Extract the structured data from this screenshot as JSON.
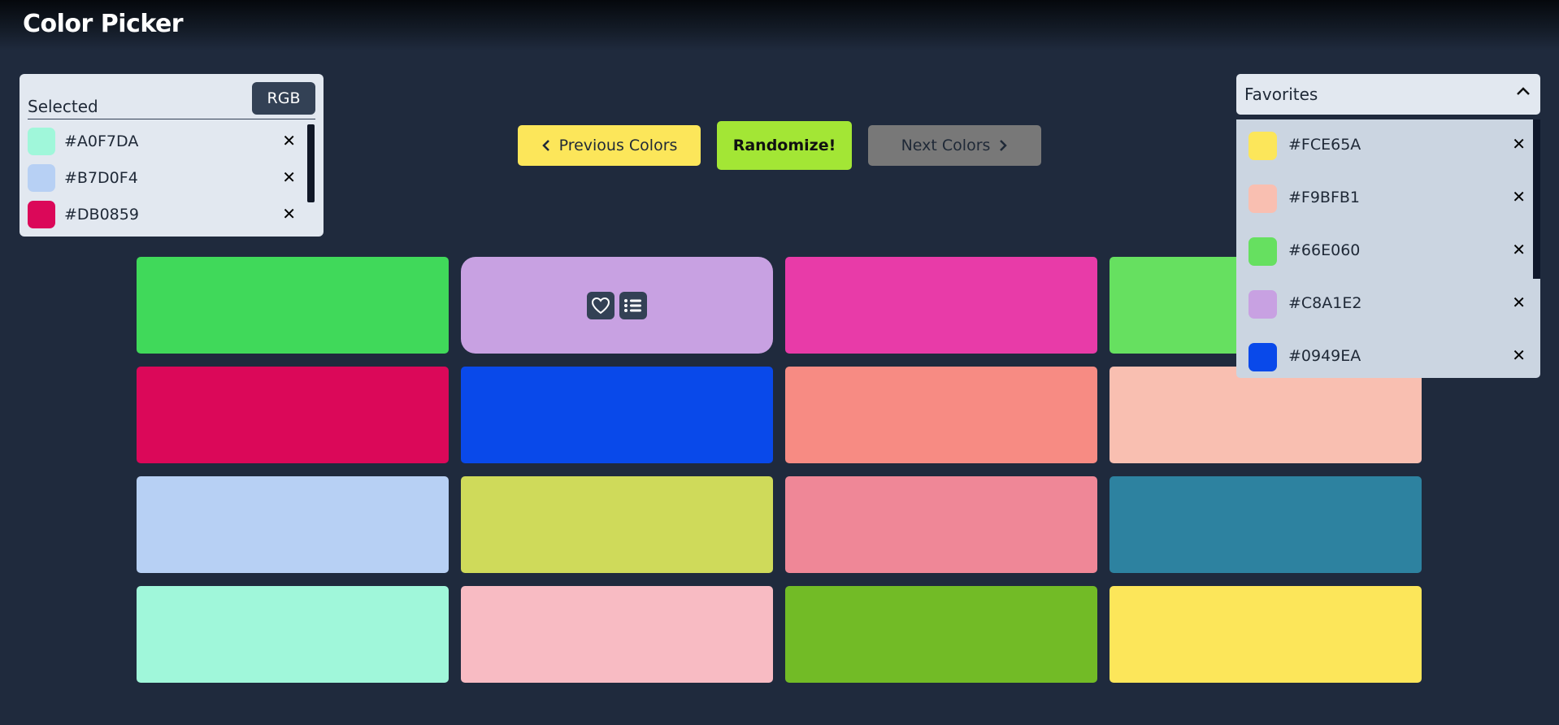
{
  "app": {
    "title": "Color Picker"
  },
  "selected": {
    "label": "Selected",
    "format_button": "RGB",
    "items": [
      {
        "hex": "#A0F7DA",
        "color": "#A0F7DA",
        "remove": "✕"
      },
      {
        "hex": "#B7D0F4",
        "color": "#B7D0F4",
        "remove": "✕"
      },
      {
        "hex": "#DB0859",
        "color": "#DB0859",
        "remove": "✕"
      }
    ]
  },
  "actions": {
    "previous": "Previous Colors",
    "randomize": "Randomize!",
    "next": "Next Colors",
    "icons": {
      "previous": "chevron-left-icon",
      "next": "chevron-right-icon"
    }
  },
  "grid": {
    "tiles": [
      "#40D95A",
      "#C8A1E2",
      "#E83BA8",
      "#66E060",
      "#DB0859",
      "#0949EA",
      "#F78B83",
      "#F9BFB1",
      "#B7D0F4",
      "#CFDA5A",
      "#EF8797",
      "#2D82A0",
      "#A0F7DA",
      "#F8BBC3",
      "#72BB26",
      "#FCE65A"
    ],
    "active_tile_icons": [
      "heart-icon",
      "list-icon"
    ]
  },
  "favorites": {
    "title": "Favorites",
    "items": [
      {
        "hex": "#FCE65A",
        "color": "#FCE65A",
        "remove": "✕"
      },
      {
        "hex": "#F9BFB1",
        "color": "#F9BFB1",
        "remove": "✕"
      },
      {
        "hex": "#66E060",
        "color": "#66E060",
        "remove": "✕"
      },
      {
        "hex": "#C8A1E2",
        "color": "#C8A1E2",
        "remove": "✕"
      },
      {
        "hex": "#0949EA",
        "color": "#0949EA",
        "remove": "✕"
      }
    ]
  }
}
